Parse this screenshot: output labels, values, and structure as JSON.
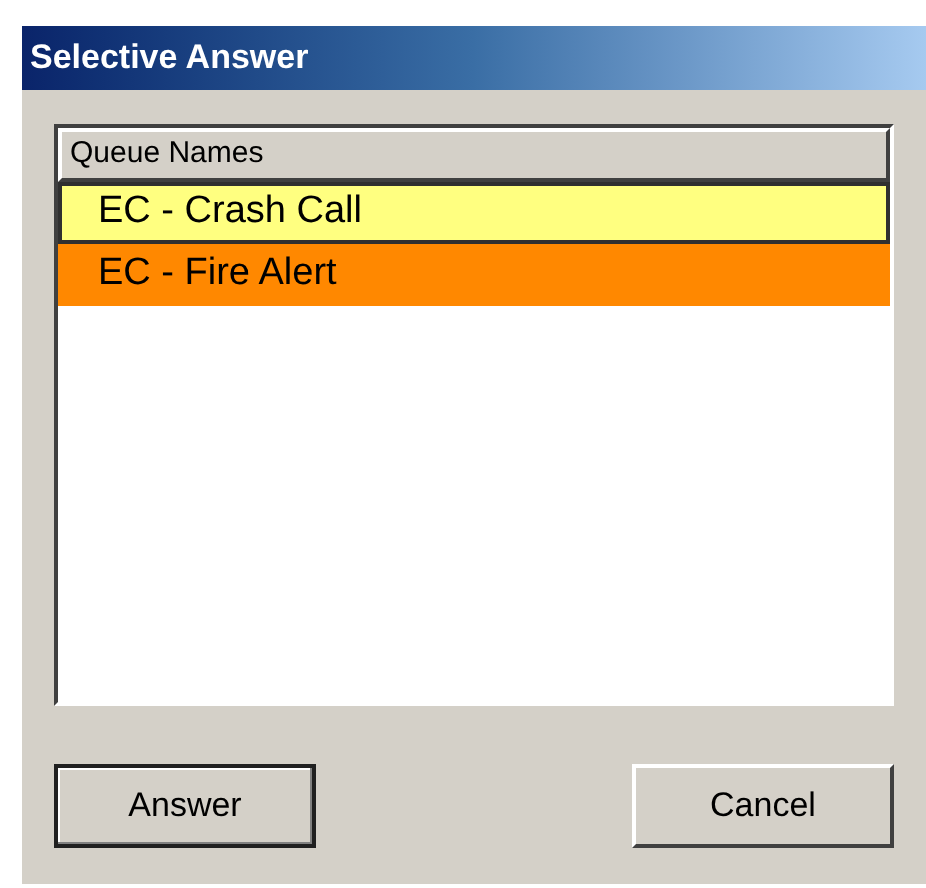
{
  "window": {
    "title": "Selective Answer"
  },
  "list": {
    "columns": [
      "Queue Names"
    ],
    "rows": [
      {
        "label": "EC - Crash Call",
        "color": "#ffff80",
        "focused": true
      },
      {
        "label": "EC - Fire Alert",
        "color": "#ff8800",
        "focused": false
      }
    ]
  },
  "buttons": [
    {
      "label": "Answer",
      "default": true
    },
    {
      "label": "Cancel",
      "default": false
    }
  ]
}
